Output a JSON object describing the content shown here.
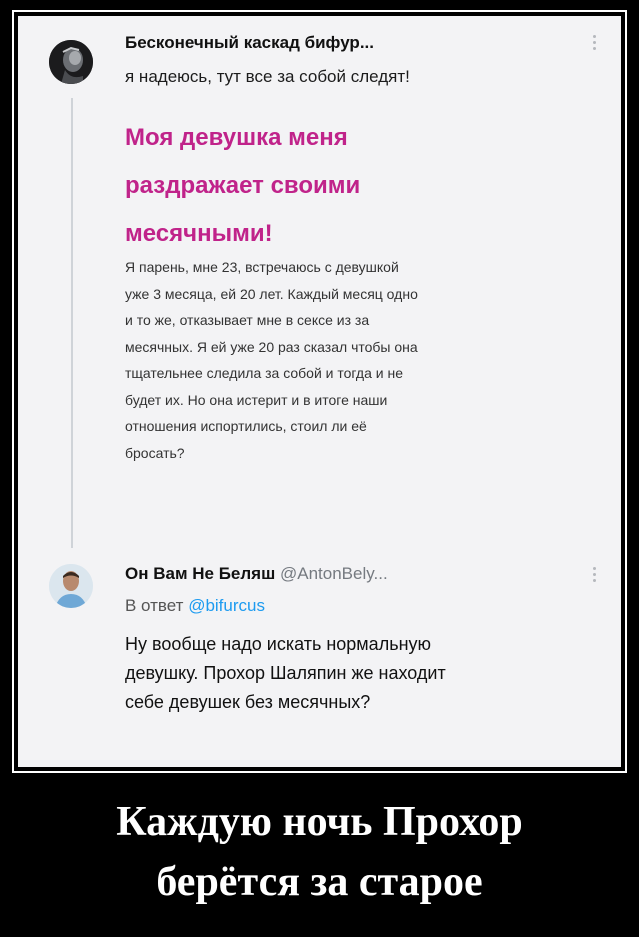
{
  "post": {
    "author": "Бесконечный каскад бифур...",
    "text": "я надеюсь, тут все за собой следят!",
    "heading_lines": [
      "Моя девушка меня",
      "раздражает своими",
      "месячными!"
    ],
    "body_lines": [
      "Я парень, мне 23, встречаюсь с девушкой",
      "уже 3 месяца, ей 20 лет. Каждый месяц одно",
      "и то же, отказывает мне в сексе из за",
      "месячных. Я ей уже 20 раз сказал чтобы она",
      "тщательнее следила за собой и тогда и не",
      "будет их. Но она истерит и в итоге наши",
      "отношения испортились, стоил ли её",
      "бросать?"
    ]
  },
  "reply": {
    "author": "Он Вам Не Беляш",
    "handle": "@AntonBely...",
    "reply_prefix": "В ответ",
    "reply_to": "@bifurcus",
    "text_lines": [
      "Ну вообще надо искать нормальную",
      "девушку. Прохор Шаляпин же находит",
      "себе девушек без месячных?"
    ]
  },
  "caption_lines": [
    "Каждую ночь Прохор",
    "берётся за старое"
  ],
  "colors": {
    "heading": "#c0238a",
    "link": "#1d9bf0",
    "background": "#000000",
    "card": "#f3f3f5"
  }
}
